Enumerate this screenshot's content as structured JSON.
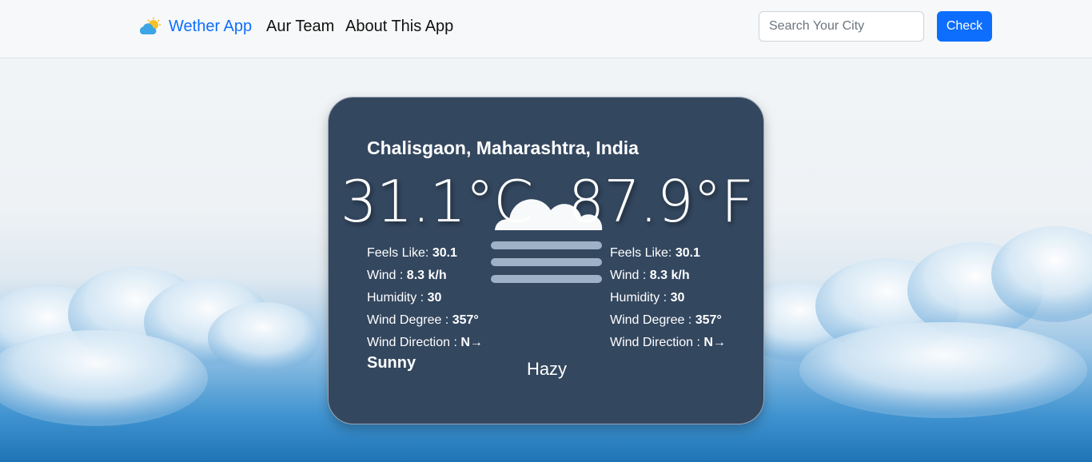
{
  "nav": {
    "brand": "Wether App",
    "team": "Aur Team",
    "about": "About This App",
    "search_placeholder": "Search Your City",
    "check_label": "Check"
  },
  "weather": {
    "location": "Chalisgaon, Maharashtra, India",
    "temp_c": "31.1°C",
    "temp_f": "87.9°F",
    "left": {
      "feels_like_label": "Feels Like: ",
      "feels_like": "30.1",
      "wind_label": "Wind : ",
      "wind": "8.3 k/h",
      "humidity_label": "Humidity : ",
      "humidity": "30",
      "wind_degree_label": "Wind Degree : ",
      "wind_degree": "357°",
      "wind_direction_label": "Wind Direction : ",
      "wind_direction": "N→"
    },
    "right": {
      "feels_like_label": "Feels Like: ",
      "feels_like": "30.1",
      "wind_label": "Wind : ",
      "wind": "8.3 k/h",
      "humidity_label": "Humidity : ",
      "humidity": "30",
      "wind_degree_label": "Wind Degree : ",
      "wind_degree": "357°",
      "wind_direction_label": "Wind Direction : ",
      "wind_direction": "N→"
    },
    "condition_left": "Sunny",
    "condition_center": "Hazy",
    "icon": "fog-cloud-icon"
  },
  "colors": {
    "brand": "#0d6efd",
    "card_bg": "#33475f",
    "button_bg": "#0d6efd"
  }
}
